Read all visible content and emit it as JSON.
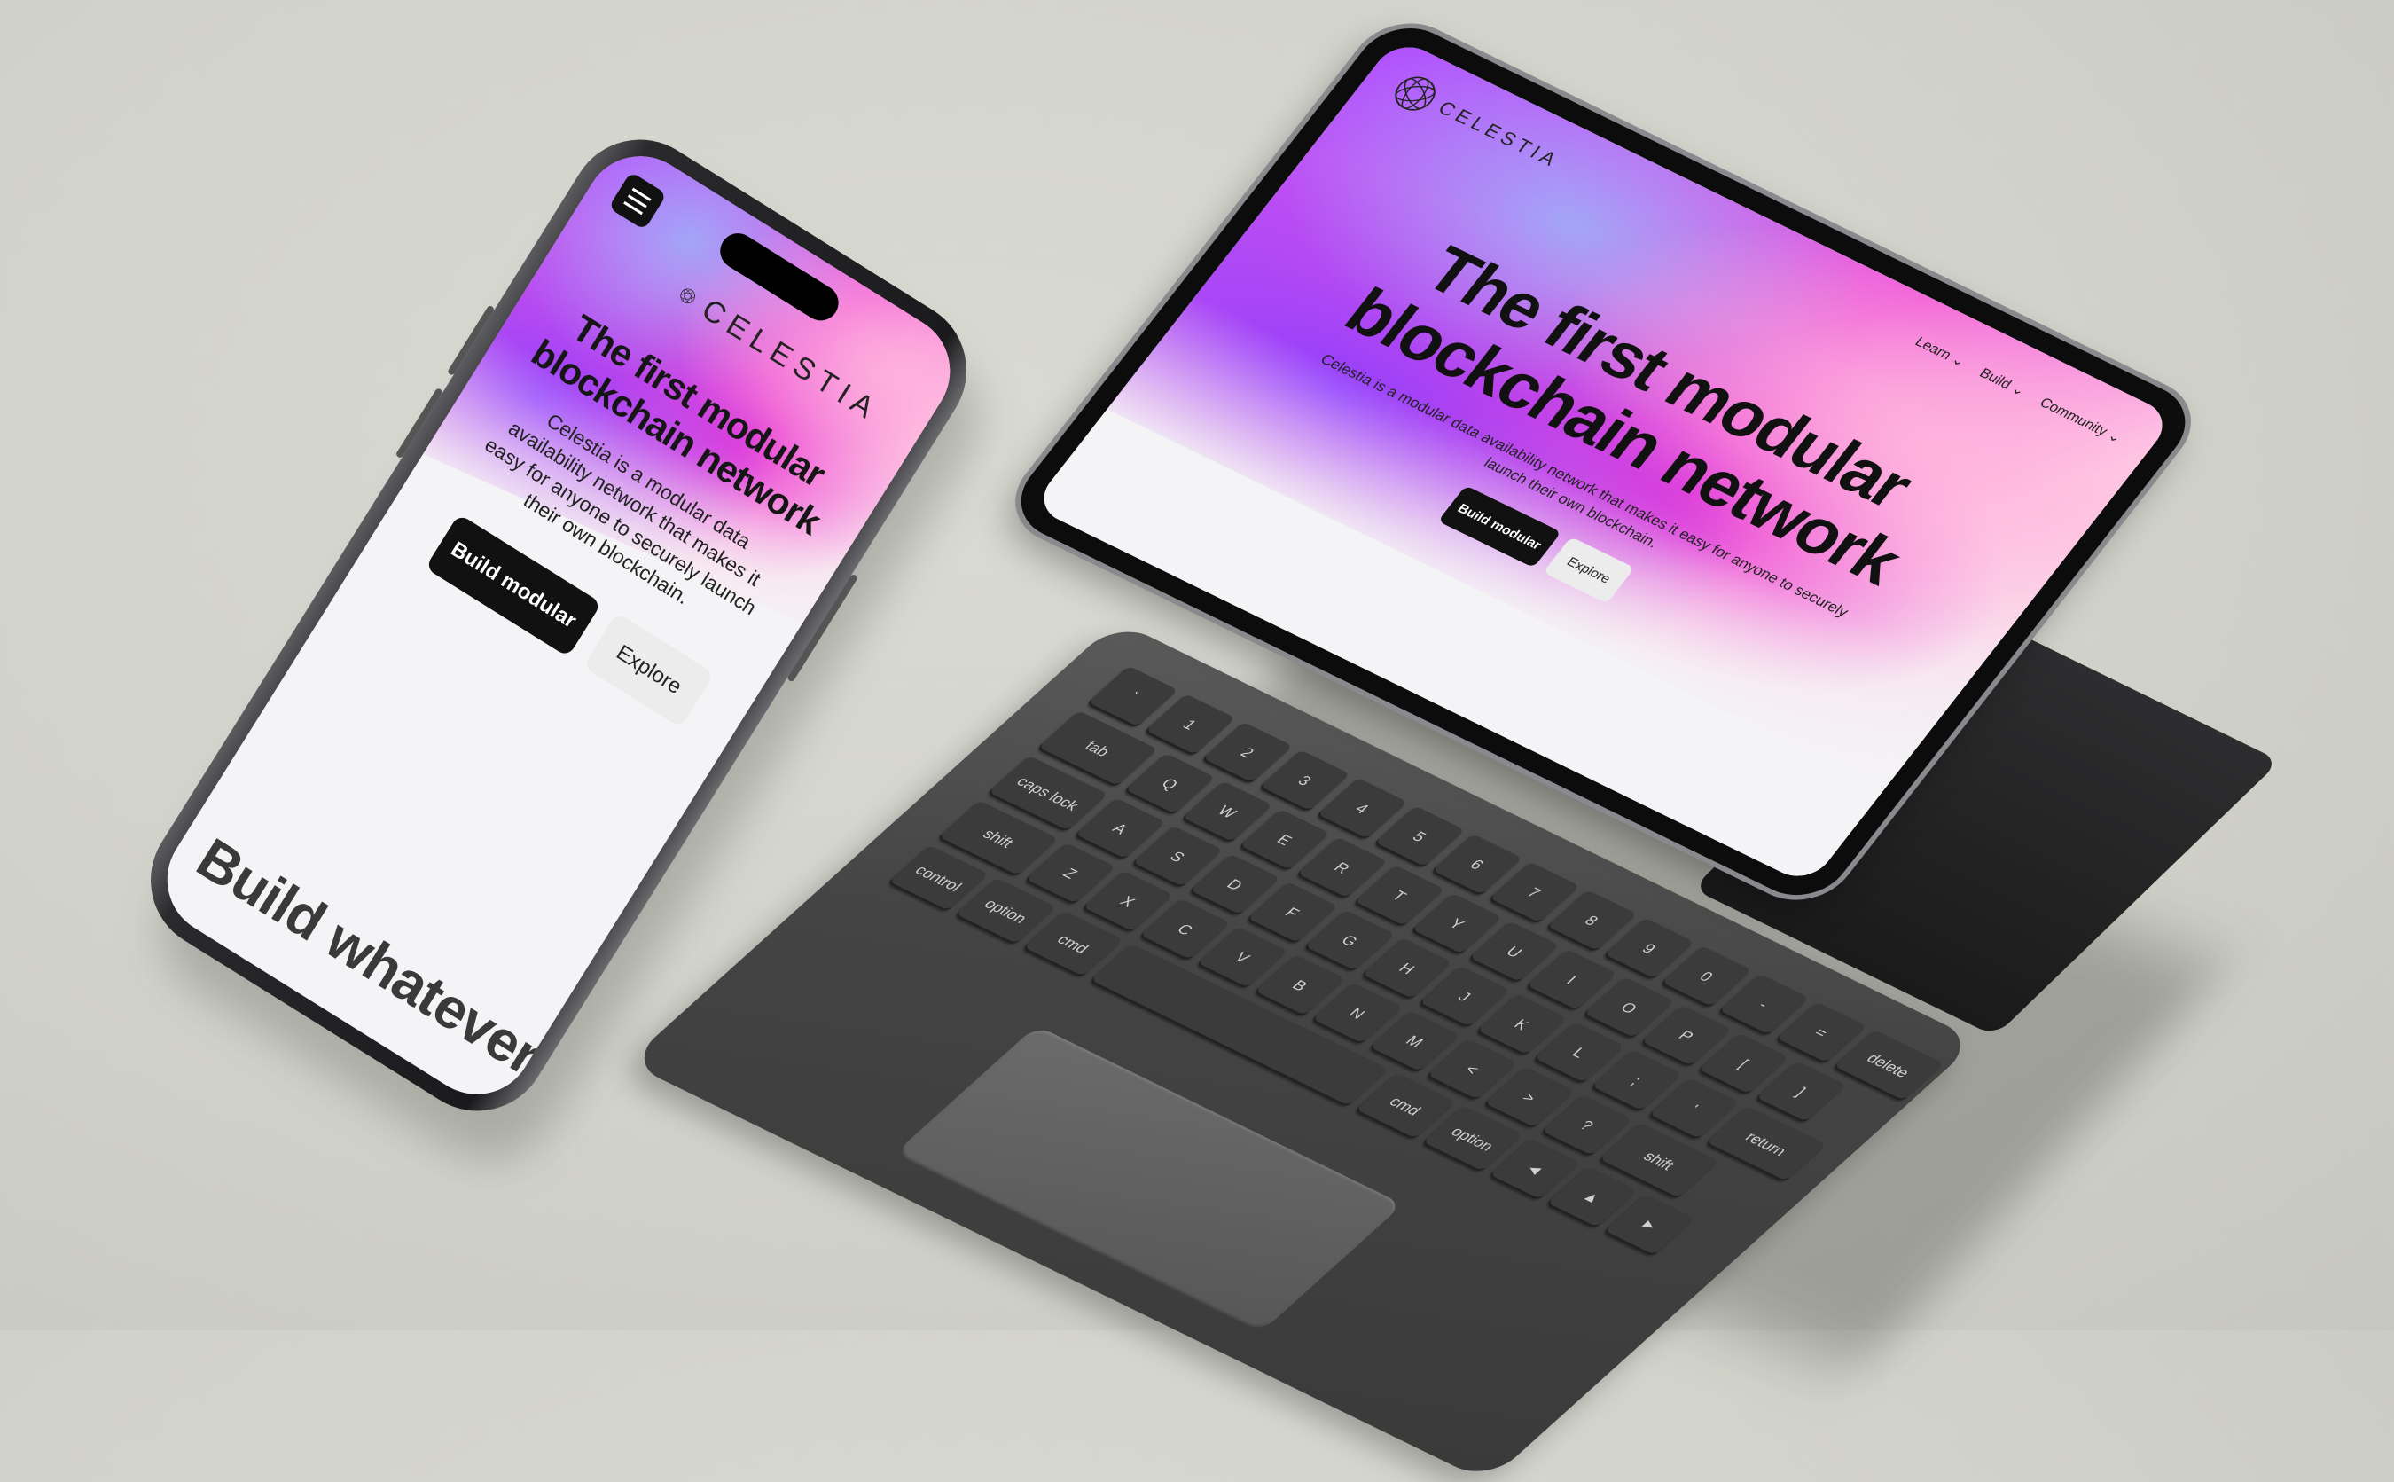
{
  "brand": {
    "name": "CELESTIA"
  },
  "hero": {
    "headline_line1": "The first modular",
    "headline_line2": "blockchain network",
    "description": "Celestia is a modular data availability network that makes it easy for anyone to securely launch their own blockchain.",
    "primary_cta": "Build modular",
    "secondary_cta": "Explore"
  },
  "nav": {
    "items": [
      {
        "label": "Learn"
      },
      {
        "label": "Build"
      },
      {
        "label": "Community"
      }
    ]
  },
  "phone": {
    "description_lines": [
      "Celestia is a modular data",
      "availability network that makes it",
      "easy for anyone to securely launch",
      "their own blockchain."
    ],
    "footer_text": "Build whatever"
  },
  "tablet": {
    "description_lines": [
      "Celestia is a modular data availability network that makes it easy for anyone to securely",
      "launch their own blockchain."
    ]
  },
  "keyboard": {
    "rows": [
      [
        "`",
        "1",
        "2",
        "3",
        "4",
        "5",
        "6",
        "7",
        "8",
        "9",
        "0",
        "-",
        "="
      ],
      [
        "tab",
        "Q",
        "W",
        "E",
        "R",
        "T",
        "Y",
        "U",
        "I",
        "O",
        "P",
        "[",
        "]"
      ],
      [
        "caps lock",
        "A",
        "S",
        "D",
        "F",
        "G",
        "H",
        "J",
        "K",
        "L",
        ";",
        "'",
        "return"
      ],
      [
        "shift",
        "Z",
        "X",
        "C",
        "V",
        "B",
        "N",
        "M",
        "<",
        ">",
        "?",
        "shift"
      ],
      [
        "control",
        "option",
        "cmd",
        "",
        "cmd",
        "option",
        "◄",
        "▲",
        "►"
      ]
    ],
    "delete_label": "delete"
  },
  "colors": {
    "background": "#d4d5cd",
    "device_frame": "#1b1b1d",
    "keyboard_body": "#4a4a4a",
    "accent_magenta": "#e24fd6",
    "accent_purple": "#8c3cff"
  },
  "icons": {
    "menu": "hamburger-icon",
    "logo": "celestia-globe-icon",
    "chevron": "chevron-down-icon"
  }
}
